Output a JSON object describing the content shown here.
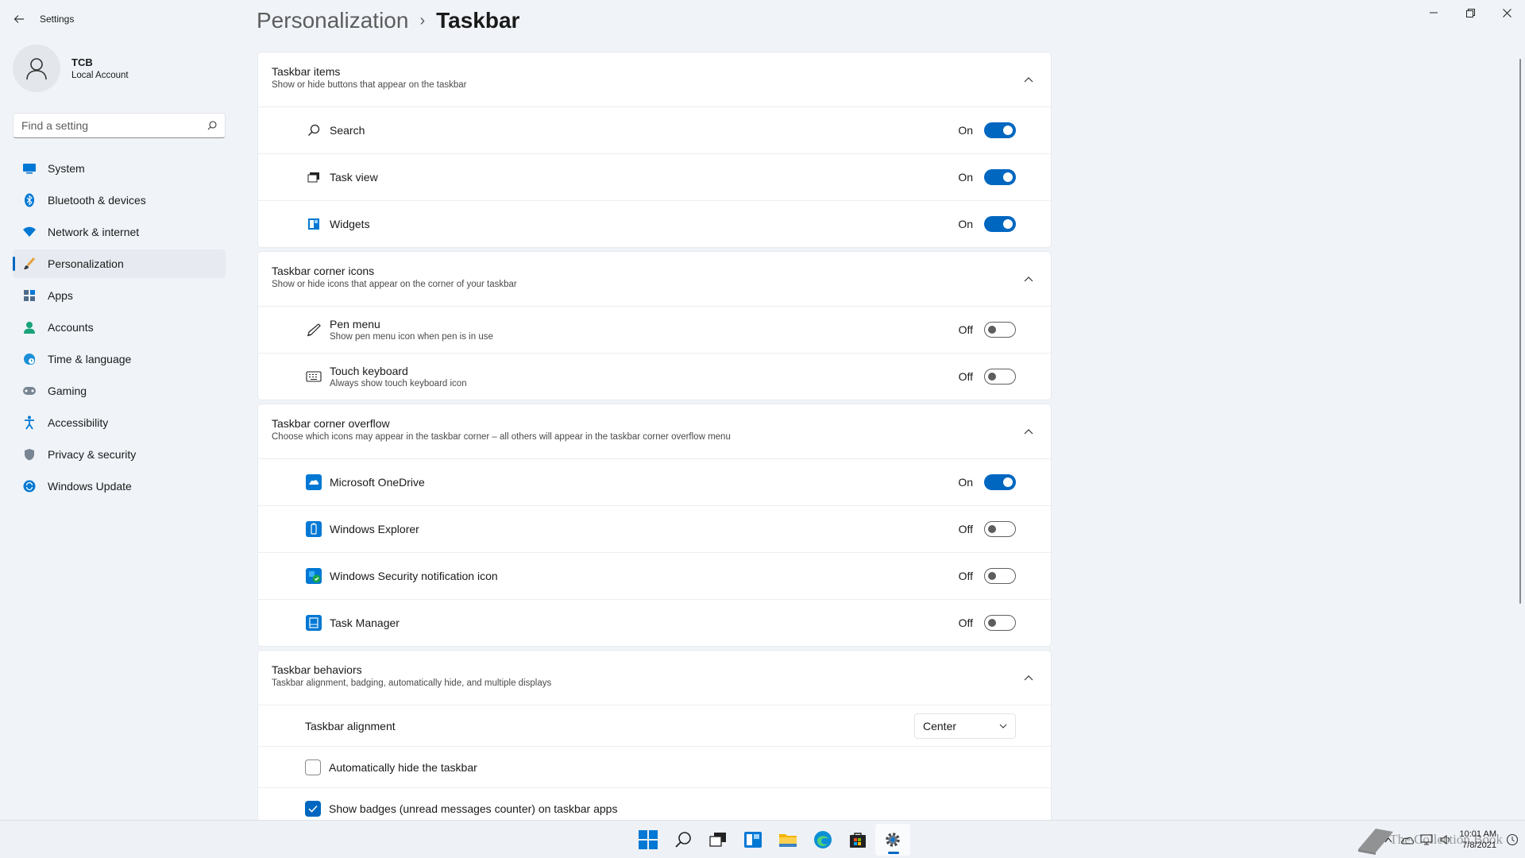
{
  "app": {
    "title": "Settings"
  },
  "profile": {
    "name": "TCB",
    "account": "Local Account"
  },
  "search": {
    "placeholder": "Find a setting"
  },
  "nav": [
    {
      "label": "System",
      "icon": "monitor-icon"
    },
    {
      "label": "Bluetooth & devices",
      "icon": "bluetooth-icon"
    },
    {
      "label": "Network & internet",
      "icon": "wifi-icon"
    },
    {
      "label": "Personalization",
      "icon": "brush-icon",
      "active": true
    },
    {
      "label": "Apps",
      "icon": "apps-icon"
    },
    {
      "label": "Accounts",
      "icon": "person-icon"
    },
    {
      "label": "Time & language",
      "icon": "globe-clock-icon"
    },
    {
      "label": "Gaming",
      "icon": "gamepad-icon"
    },
    {
      "label": "Accessibility",
      "icon": "accessibility-icon"
    },
    {
      "label": "Privacy & security",
      "icon": "shield-icon"
    },
    {
      "label": "Windows Update",
      "icon": "update-icon"
    }
  ],
  "breadcrumb": {
    "parent": "Personalization",
    "separator": "›",
    "current": "Taskbar"
  },
  "groups": {
    "items": {
      "title": "Taskbar items",
      "subtitle": "Show or hide buttons that appear on the taskbar",
      "rows": [
        {
          "label": "Search",
          "state": "On",
          "on": true
        },
        {
          "label": "Task view",
          "state": "On",
          "on": true
        },
        {
          "label": "Widgets",
          "state": "On",
          "on": true
        }
      ]
    },
    "corner_icons": {
      "title": "Taskbar corner icons",
      "subtitle": "Show or hide icons that appear on the corner of your taskbar",
      "rows": [
        {
          "label": "Pen menu",
          "sub": "Show pen menu icon when pen is in use",
          "state": "Off",
          "on": false
        },
        {
          "label": "Touch keyboard",
          "sub": "Always show touch keyboard icon",
          "state": "Off",
          "on": false
        }
      ]
    },
    "overflow": {
      "title": "Taskbar corner overflow",
      "subtitle": "Choose which icons may appear in the taskbar corner – all others will appear in the taskbar corner overflow menu",
      "rows": [
        {
          "label": "Microsoft OneDrive",
          "state": "On",
          "on": true
        },
        {
          "label": "Windows Explorer",
          "state": "Off",
          "on": false
        },
        {
          "label": "Windows Security notification icon",
          "state": "Off",
          "on": false
        },
        {
          "label": "Task Manager",
          "state": "Off",
          "on": false
        }
      ]
    },
    "behaviors": {
      "title": "Taskbar behaviors",
      "subtitle": "Taskbar alignment, badging, automatically hide, and multiple displays",
      "alignment_label": "Taskbar alignment",
      "alignment_value": "Center",
      "autohide_label": "Automatically hide the taskbar",
      "autohide_checked": false,
      "badges_label": "Show badges (unread messages counter) on taskbar apps",
      "badges_checked": true
    }
  },
  "taskbar": {
    "apps": [
      "start-icon",
      "search-icon",
      "task-view-icon",
      "widgets-icon",
      "file-explorer-icon",
      "edge-icon",
      "store-icon",
      "settings-icon"
    ],
    "clock_time": "10:01 AM",
    "clock_date": "7/8/2021",
    "watermark": "The Collection Book"
  },
  "colors": {
    "accent": "#0067c0",
    "background": "#f0f4f9"
  }
}
